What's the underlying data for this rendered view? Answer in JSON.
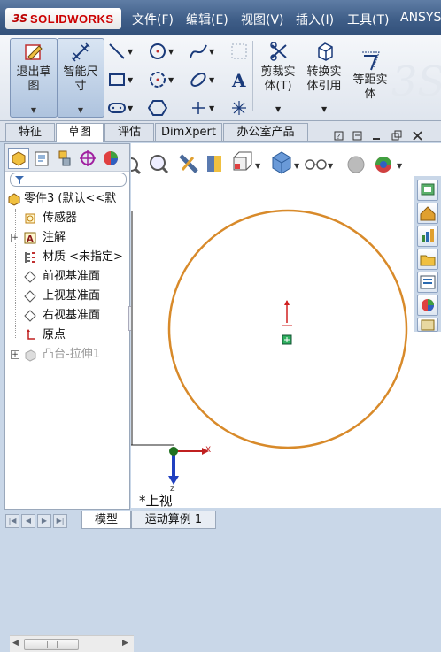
{
  "app": {
    "logo_prefix": "3S",
    "logo_text": "SOLIDWORKS"
  },
  "menu": [
    "文件(F)",
    "编辑(E)",
    "视图(V)",
    "插入(I)",
    "工具(T)",
    "ANSYS"
  ],
  "toolbar": {
    "exit_sketch": [
      "退出草",
      "图"
    ],
    "smart_dimension": [
      "智能尺",
      "寸"
    ],
    "trim": [
      "剪裁实",
      "体(T)"
    ],
    "convert": [
      "转换实",
      "体引用"
    ],
    "offset": [
      "等距实",
      "体"
    ],
    "drop_arrow": "▼"
  },
  "tabs": [
    "特征",
    "草图",
    "评估",
    "DimXpert",
    "办公室产品"
  ],
  "active_tab": "草图",
  "tree": {
    "root": "零件3 (默认<<默",
    "items": [
      {
        "label": "传感器",
        "expandable": false,
        "icon": "sensor-icon"
      },
      {
        "label": "注解",
        "expandable": true,
        "icon": "annotation-icon"
      },
      {
        "label": "材质 <未指定>",
        "expandable": false,
        "icon": "material-icon"
      },
      {
        "label": "前视基准面",
        "expandable": false,
        "icon": "plane-icon"
      },
      {
        "label": "上视基准面",
        "expandable": false,
        "icon": "plane-icon"
      },
      {
        "label": "右视基准面",
        "expandable": false,
        "icon": "plane-icon"
      },
      {
        "label": "原点",
        "expandable": false,
        "icon": "origin-icon"
      },
      {
        "label": "凸台-拉伸1",
        "expandable": true,
        "icon": "boss-extrude-icon",
        "suppressed": true
      }
    ],
    "expand_symbol": "+"
  },
  "viewport": {
    "view_label": "*上视",
    "axis_x": "X",
    "axis_z": "Z",
    "sketch_color": "#d88a2a"
  },
  "bottom_tabs": [
    "模型",
    "运动算例 1"
  ],
  "active_bottom_tab": "模型"
}
